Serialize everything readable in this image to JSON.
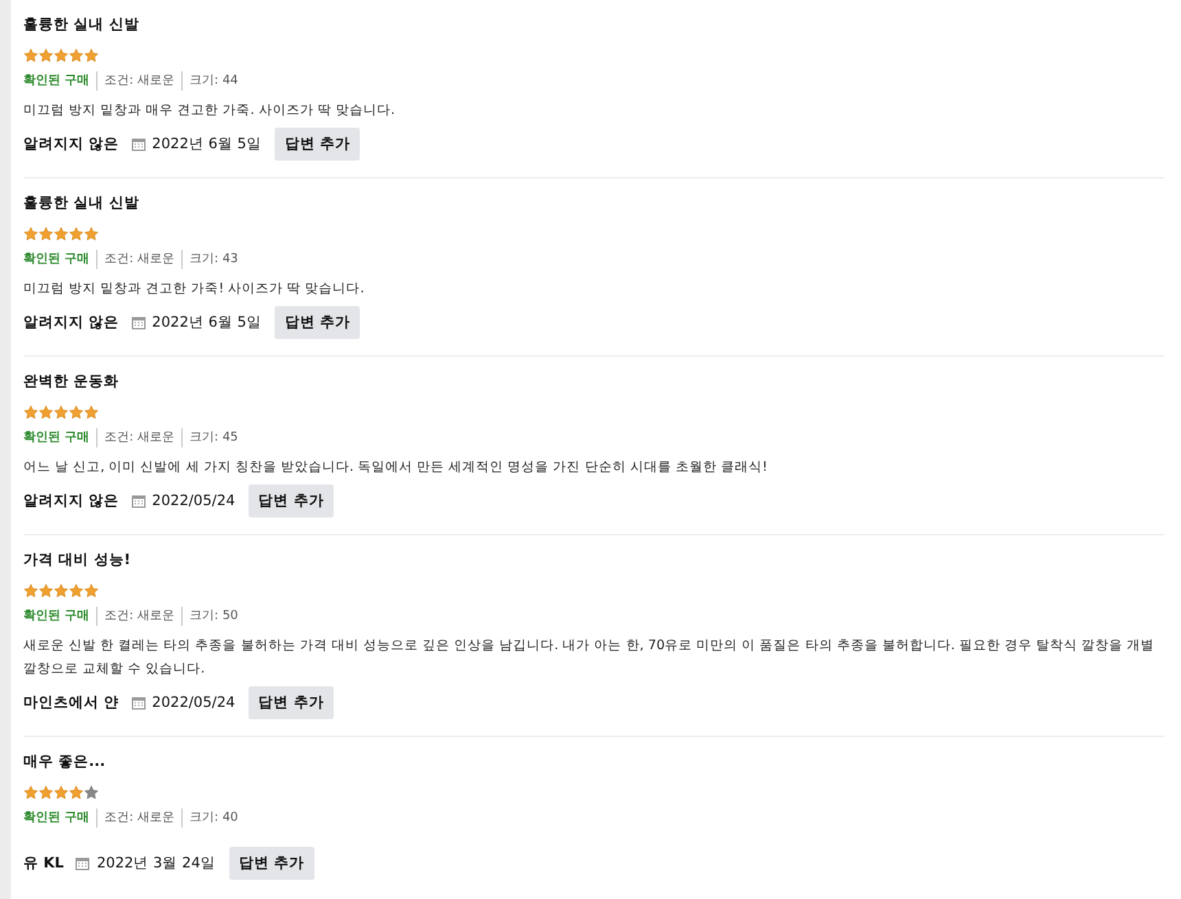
{
  "reviews": [
    {
      "title": "훌륭한 실내 신발",
      "stars": 5,
      "verified": "확인된 구매",
      "condition": "조건: 새로운",
      "size": "크기: 44",
      "text": "미끄럼 방지 밑창과 매우 견고한 가죽. 사이즈가 딱 맞습니다.",
      "author": "알려지지 않은",
      "date": "2022년 6월 5일",
      "reply": "답변 추가"
    },
    {
      "title": "훌륭한 실내 신발",
      "stars": 5,
      "verified": "확인된 구매",
      "condition": "조건: 새로운",
      "size": "크기: 43",
      "text": "미끄럼 방지 밑창과 견고한 가죽! 사이즈가 딱 맞습니다.",
      "author": "알려지지 않은",
      "date": "2022년 6월 5일",
      "reply": "답변 추가"
    },
    {
      "title": "완벽한 운동화",
      "stars": 5,
      "verified": "확인된 구매",
      "condition": "조건: 새로운",
      "size": "크기: 45",
      "text": "어느 날 신고, 이미 신발에 세 가지 칭찬을 받았습니다. 독일에서 만든 세계적인 명성을 가진 단순히 시대를 초월한 클래식!",
      "author": "알려지지 않은",
      "date": "2022/05/24",
      "reply": "답변 추가"
    },
    {
      "title": "가격 대비 성능!",
      "stars": 5,
      "verified": "확인된 구매",
      "condition": "조건: 새로운",
      "size": "크기: 50",
      "text": "새로운 신발 한 켤레는 타의 추종을 불허하는 가격 대비 성능으로 깊은 인상을 남깁니다. 내가 아는 한, 70유로 미만의 이 품질은 타의 추종을 불허합니다. 필요한 경우 탈착식 깔창을 개별 깔창으로 교체할 수 있습니다.",
      "author": "마인츠에서 얀",
      "date": "2022/05/24",
      "reply": "답변 추가"
    },
    {
      "title": "매우 좋은...",
      "stars": 4,
      "verified": "확인된 구매",
      "condition": "조건: 새로운",
      "size": "크기: 40",
      "author": "유 KL",
      "date": "2022년 3월 24일",
      "reply": "답변 추가"
    }
  ]
}
